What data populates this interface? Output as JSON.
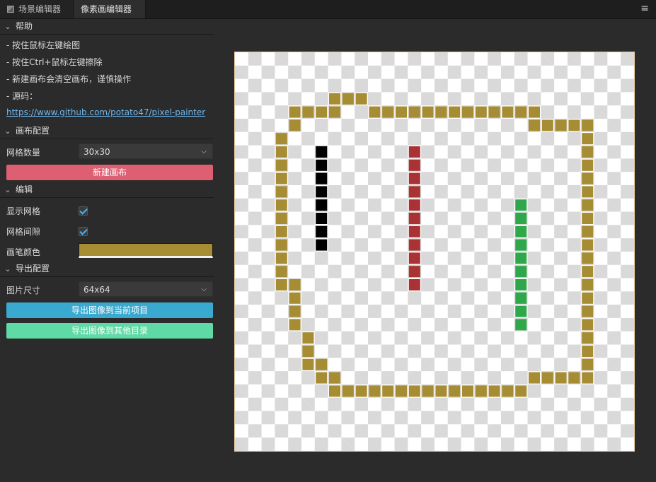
{
  "tabs": [
    {
      "label": "场景编辑器",
      "icon": "scene-icon",
      "active": false
    },
    {
      "label": "像素画编辑器",
      "active": true
    }
  ],
  "menu_icon": "≡",
  "help": {
    "title": "帮助",
    "lines": [
      "- 按住鼠标左键绘图",
      "- 按住Ctrl+鼠标左键擦除",
      "- 新建画布会清空画布，谨慎操作",
      "- 源码："
    ],
    "link": "https://www.github.com/potato47/pixel-painter"
  },
  "canvas_config": {
    "title": "画布配置",
    "grid_count_label": "网格数量",
    "grid_count_value": "30x30",
    "new_canvas_label": "新建画布",
    "new_canvas_color": "#de5e72"
  },
  "edit": {
    "title": "编辑",
    "show_grid_label": "显示网格",
    "show_grid": true,
    "grid_gap_label": "网格间隙",
    "grid_gap": true,
    "brush_color_label": "画笔颜色",
    "brush_color": "#a68c33"
  },
  "export": {
    "title": "导出配置",
    "size_label": "图片尺寸",
    "size_value": "64x64",
    "export_project_label": "导出图像到当前项目",
    "export_project_color": "#3aa9cf",
    "export_other_label": "导出图像到其他目录",
    "export_other_color": "#5fd9a5"
  },
  "canvas": {
    "grid_size": 30,
    "palette": {
      "gold": "#a68c33",
      "black": "#000000",
      "red": "#a83234",
      "green": "#2ea84b"
    },
    "pixels": {
      "gold": [
        [
          3,
          7
        ],
        [
          3,
          8
        ],
        [
          3,
          9
        ],
        [
          4,
          4
        ],
        [
          4,
          5
        ],
        [
          4,
          6
        ],
        [
          4,
          7
        ],
        [
          4,
          10
        ],
        [
          4,
          11
        ],
        [
          4,
          12
        ],
        [
          4,
          13
        ],
        [
          4,
          14
        ],
        [
          4,
          15
        ],
        [
          4,
          16
        ],
        [
          4,
          17
        ],
        [
          4,
          18
        ],
        [
          4,
          19
        ],
        [
          4,
          20
        ],
        [
          4,
          21
        ],
        [
          4,
          22
        ],
        [
          5,
          4
        ],
        [
          5,
          22
        ],
        [
          5,
          23
        ],
        [
          5,
          24
        ],
        [
          5,
          25
        ],
        [
          5,
          26
        ],
        [
          6,
          3
        ],
        [
          6,
          26
        ],
        [
          7,
          3
        ],
        [
          7,
          26
        ],
        [
          8,
          3
        ],
        [
          8,
          26
        ],
        [
          9,
          3
        ],
        [
          9,
          26
        ],
        [
          10,
          3
        ],
        [
          10,
          26
        ],
        [
          11,
          3
        ],
        [
          11,
          26
        ],
        [
          12,
          3
        ],
        [
          12,
          26
        ],
        [
          13,
          3
        ],
        [
          13,
          26
        ],
        [
          14,
          3
        ],
        [
          14,
          26
        ],
        [
          15,
          3
        ],
        [
          15,
          26
        ],
        [
          16,
          3
        ],
        [
          16,
          26
        ],
        [
          17,
          3
        ],
        [
          17,
          4
        ],
        [
          17,
          26
        ],
        [
          18,
          4
        ],
        [
          18,
          26
        ],
        [
          19,
          4
        ],
        [
          19,
          26
        ],
        [
          20,
          4
        ],
        [
          20,
          26
        ],
        [
          21,
          5
        ],
        [
          21,
          26
        ],
        [
          22,
          5
        ],
        [
          22,
          26
        ],
        [
          23,
          5
        ],
        [
          23,
          6
        ],
        [
          23,
          26
        ],
        [
          24,
          6
        ],
        [
          24,
          7
        ],
        [
          24,
          22
        ],
        [
          24,
          23
        ],
        [
          24,
          24
        ],
        [
          24,
          25
        ],
        [
          24,
          26
        ],
        [
          25,
          7
        ],
        [
          25,
          8
        ],
        [
          25,
          9
        ],
        [
          25,
          10
        ],
        [
          25,
          11
        ],
        [
          25,
          12
        ],
        [
          25,
          13
        ],
        [
          25,
          14
        ],
        [
          25,
          15
        ],
        [
          25,
          16
        ],
        [
          25,
          17
        ],
        [
          25,
          18
        ],
        [
          25,
          19
        ],
        [
          25,
          20
        ],
        [
          25,
          21
        ]
      ],
      "black": [
        [
          7,
          6
        ],
        [
          8,
          6
        ],
        [
          9,
          6
        ],
        [
          10,
          6
        ],
        [
          11,
          6
        ],
        [
          12,
          6
        ],
        [
          13,
          6
        ],
        [
          14,
          6
        ]
      ],
      "red": [
        [
          7,
          13
        ],
        [
          8,
          13
        ],
        [
          9,
          13
        ],
        [
          10,
          13
        ],
        [
          11,
          13
        ],
        [
          12,
          13
        ],
        [
          13,
          13
        ],
        [
          14,
          13
        ],
        [
          15,
          13
        ],
        [
          16,
          13
        ],
        [
          17,
          13
        ]
      ],
      "green": [
        [
          11,
          21
        ],
        [
          12,
          21
        ],
        [
          13,
          21
        ],
        [
          14,
          21
        ],
        [
          15,
          21
        ],
        [
          16,
          21
        ],
        [
          17,
          21
        ],
        [
          18,
          21
        ],
        [
          19,
          21
        ],
        [
          20,
          21
        ]
      ]
    }
  }
}
